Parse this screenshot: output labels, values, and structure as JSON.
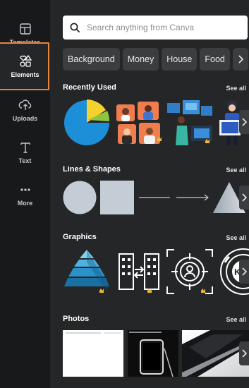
{
  "rail": {
    "items": [
      {
        "label": "Templates",
        "icon": "templates-icon"
      },
      {
        "label": "Elements",
        "icon": "elements-icon"
      },
      {
        "label": "Uploads",
        "icon": "uploads-icon"
      },
      {
        "label": "Text",
        "icon": "text-icon"
      },
      {
        "label": "More",
        "icon": "more-icon"
      }
    ],
    "active": "Elements"
  },
  "search": {
    "placeholder": "Search anything from Canva"
  },
  "chips": [
    "Background",
    "Money",
    "House",
    "Food"
  ],
  "sections": {
    "recent": {
      "title": "Recently Used",
      "see_all": "See all"
    },
    "lines": {
      "title": "Lines & Shapes",
      "see_all": "See all"
    },
    "graphics": {
      "title": "Graphics",
      "see_all": "See all"
    },
    "photos": {
      "title": "Photos",
      "see_all": "See all"
    }
  },
  "colors": {
    "accent": "#e8843f",
    "crown": "#f5b731",
    "panel": "#252627",
    "rail": "#18191b"
  }
}
